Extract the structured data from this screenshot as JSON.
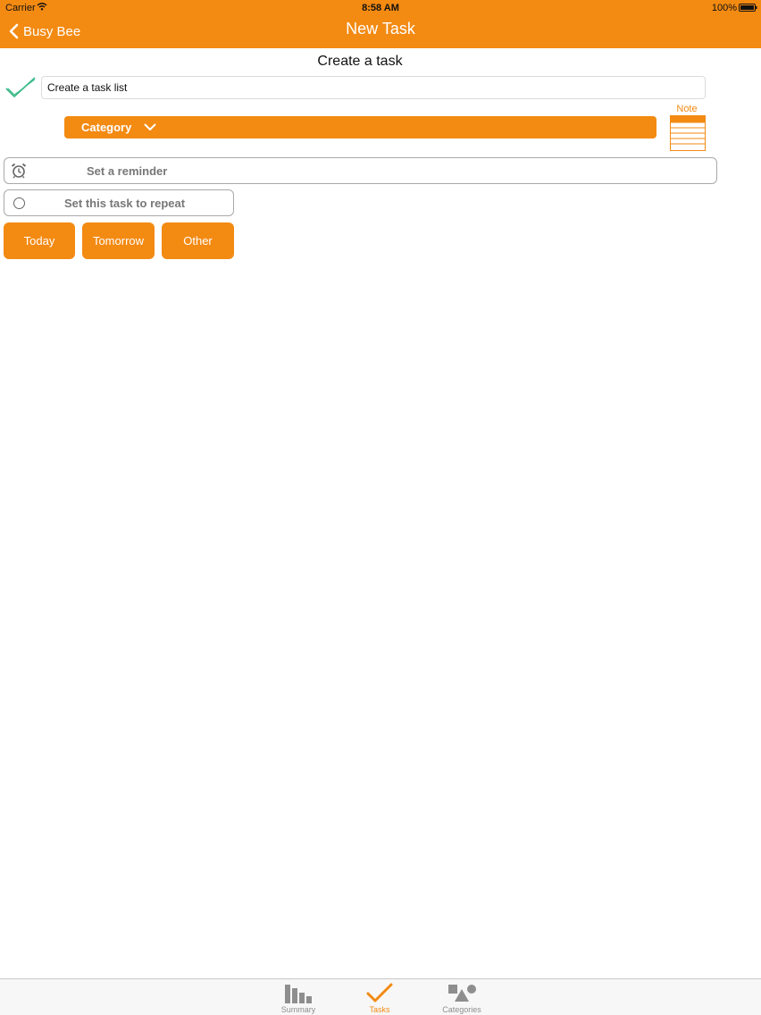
{
  "status_bar": {
    "carrier": "Carrier",
    "time": "8:58 AM",
    "battery": "100%"
  },
  "nav": {
    "back_label": "Busy Bee",
    "title": "New Task"
  },
  "form": {
    "heading": "Create a task",
    "task_name_value": "Create a task list",
    "category_label": "Category",
    "note_label": "Note",
    "reminder_label": "Set a reminder",
    "repeat_label": "Set this task to repeat",
    "repeat_selected": false
  },
  "day_buttons": [
    {
      "label": "Today"
    },
    {
      "label": "Tomorrow"
    },
    {
      "label": "Other"
    }
  ],
  "tab_bar": {
    "active": "Tasks",
    "tabs": [
      {
        "label": "Summary",
        "icon": "bar-chart-icon"
      },
      {
        "label": "Tasks",
        "icon": "checkmark-icon"
      },
      {
        "label": "Categories",
        "icon": "shapes-icon"
      }
    ]
  },
  "colors": {
    "accent": "#F38A12",
    "check_green": "#3DBB8A",
    "placeholder_gray": "#777777",
    "tab_inactive": "#8E8E8E"
  }
}
